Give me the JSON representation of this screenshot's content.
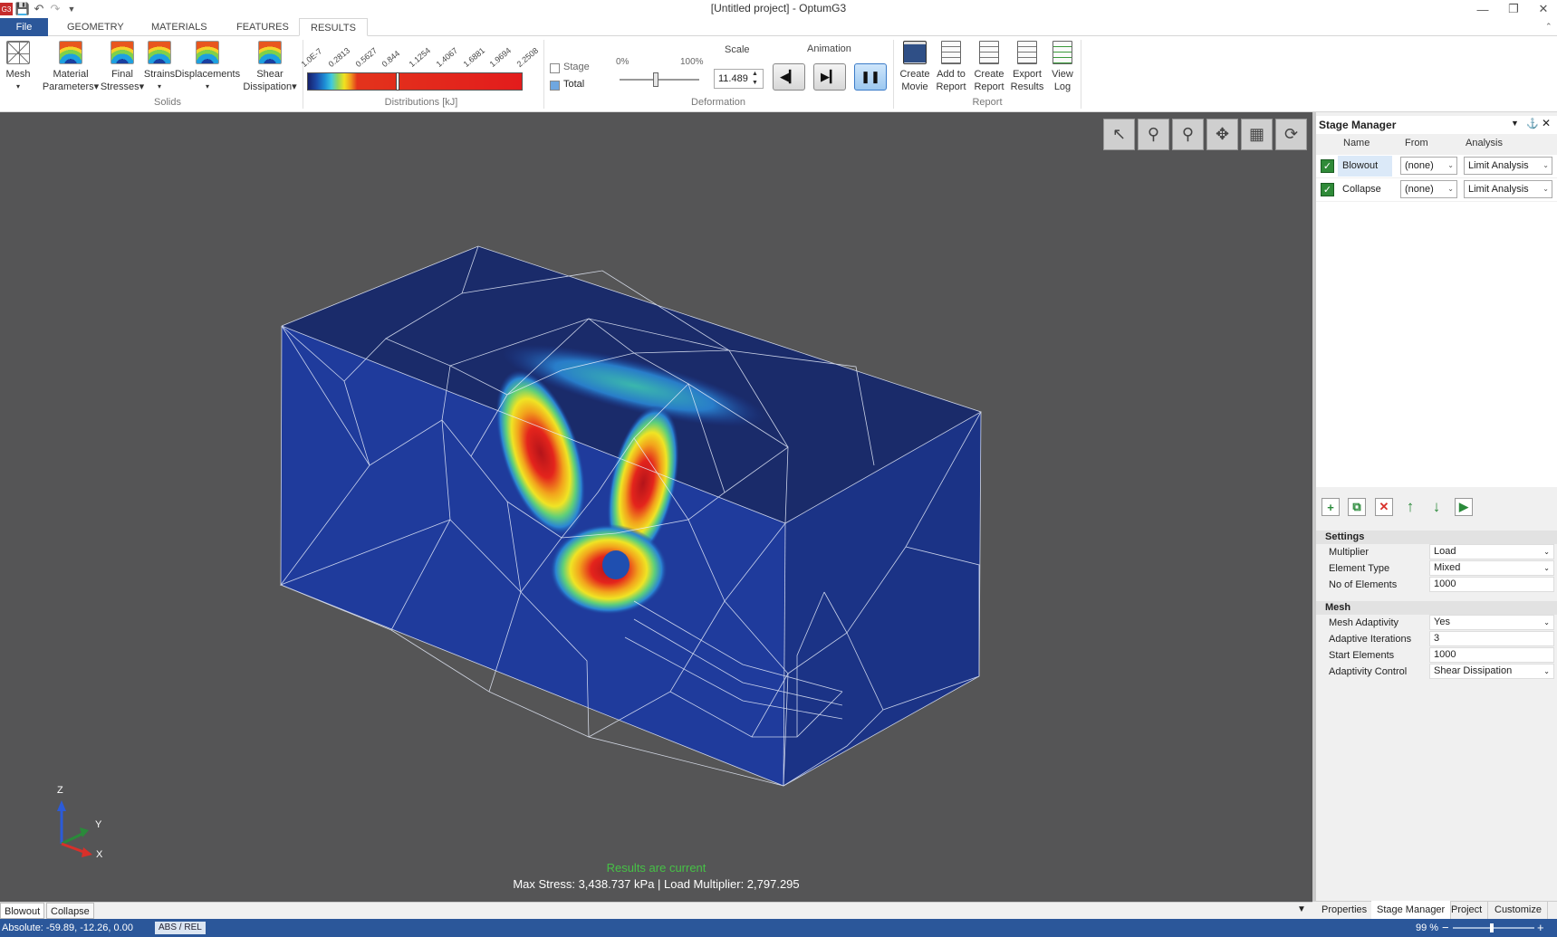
{
  "window": {
    "title": "[Untitled project] - OptumG3"
  },
  "quick_access": [
    "save-icon",
    "undo-icon",
    "redo-icon",
    "customize-icon"
  ],
  "ribbon_tabs": [
    "File",
    "GEOMETRY",
    "MATERIALS",
    "FEATURES",
    "RESULTS"
  ],
  "ribbon": {
    "mesh": "Mesh",
    "material_parameters": [
      "Material",
      "Parameters"
    ],
    "final_stresses": [
      "Final",
      "Stresses"
    ],
    "strains": "Strains",
    "displacements": "Displacements",
    "shear_dissipation": [
      "Shear",
      "Dissipation"
    ],
    "solids_group": "Solids",
    "distributions_group": "Distributions [kJ]",
    "colorbar_ticks": [
      "1.0E-7",
      "0.2813",
      "0.5627",
      "0.844",
      "1.1254",
      "1.4067",
      "1.6881",
      "1.9694",
      "2.2508"
    ],
    "stage_label": "Stage",
    "total_label": "Total",
    "slider_min": "0%",
    "slider_max": "100%",
    "slider_value": 0.45,
    "scale_label": "Scale",
    "scale_value": "11.489",
    "deformation_group": "Deformation",
    "animation_label": "Animation",
    "create_movie": [
      "Create",
      "Movie"
    ],
    "add_to_report": [
      "Add to",
      "Report"
    ],
    "create_report": [
      "Create",
      "Report"
    ],
    "export_results": [
      "Export",
      "Results"
    ],
    "view_log": [
      "View",
      "Log"
    ],
    "report_group": "Report"
  },
  "viewport": {
    "status": "Results are current",
    "summary": "Max Stress:  3,438.737 kPa | Load Multiplier:  2,797.295",
    "axes": {
      "z": "Z",
      "y": "Y",
      "x": "X"
    }
  },
  "stage_manager": {
    "title": "Stage Manager",
    "columns": [
      "Name",
      "From",
      "Analysis"
    ],
    "stages": [
      {
        "name": "Blowout",
        "from": "(none)",
        "analysis": "Limit Analysis"
      },
      {
        "name": "Collapse",
        "from": "(none)",
        "analysis": "Limit Analysis"
      }
    ]
  },
  "settings": {
    "title": "Settings",
    "rows": [
      {
        "key": "Multiplier",
        "value": "Load"
      },
      {
        "key": "Element Type",
        "value": "Mixed"
      },
      {
        "key": "No of Elements",
        "value": "1000"
      }
    ]
  },
  "mesh_settings": {
    "title": "Mesh",
    "rows": [
      {
        "key": "Mesh Adaptivity",
        "value": "Yes"
      },
      {
        "key": "Adaptive Iterations",
        "value": "3"
      },
      {
        "key": "Start Elements",
        "value": "1000"
      },
      {
        "key": "Adaptivity Control",
        "value": "Shear Dissipation"
      }
    ]
  },
  "panel_tabs": [
    "Properties",
    "Stage Manager",
    "Project",
    "Customize"
  ],
  "stage_tabs": [
    "Blowout",
    "Collapse"
  ],
  "status": {
    "coords": "Absolute: -59.89, -12.26, 0.00",
    "mode": "ABS / REL",
    "zoom": "99 %"
  },
  "colors": {
    "accent": "#2b579a",
    "checkbox": "#2f8a38",
    "results_ok": "#46c146",
    "viewport_bg": "#555556"
  }
}
